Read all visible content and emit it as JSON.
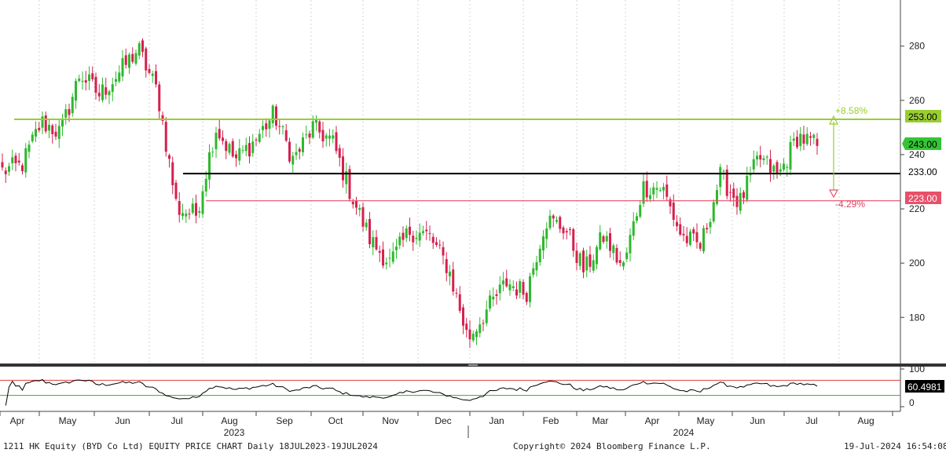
{
  "chart_data": {
    "type": "candlestick",
    "ylim": [
      163,
      297
    ],
    "yticks": [
      180,
      200,
      220,
      240,
      260,
      280
    ],
    "colors": {
      "up": "#2eb82e",
      "down": "#d6204e",
      "last_price_tag": "#35c435",
      "resistance": "#9acd32",
      "support": "#e8506a",
      "level": "#000000",
      "rsi": "#000000",
      "rsi_upper": "#e04040",
      "rsi_lower": "#30b030"
    },
    "months": [
      "Apr",
      "May",
      "Jun",
      "Jul",
      "Aug",
      "Sep",
      "Oct",
      "Nov",
      "Dec",
      "Jan",
      "Feb",
      "Mar",
      "Apr",
      "May",
      "Jun",
      "Jul",
      "Aug"
    ],
    "years": [
      "2023",
      "2024"
    ],
    "anchors": [
      {
        "label": "start",
        "value": 234
      },
      {
        "label": "May",
        "value": 236
      },
      {
        "label": "May",
        "value": 252
      },
      {
        "label": "Jun",
        "value": 248
      },
      {
        "label": "Jun",
        "value": 270
      },
      {
        "label": "Jul",
        "value": 262
      },
      {
        "label": "Jul",
        "value": 270
      },
      {
        "label": "Jul",
        "value": 279
      },
      {
        "label": "Aug",
        "value": 263
      },
      {
        "label": "Aug",
        "value": 220
      },
      {
        "label": "Aug",
        "value": 218
      },
      {
        "label": "Sep",
        "value": 250
      },
      {
        "label": "Sep",
        "value": 238
      },
      {
        "label": "Oct",
        "value": 245
      },
      {
        "label": "Oct",
        "value": 255
      },
      {
        "label": "Oct",
        "value": 238
      },
      {
        "label": "Nov",
        "value": 250
      },
      {
        "label": "Nov",
        "value": 245
      },
      {
        "label": "Nov",
        "value": 225
      },
      {
        "label": "Dec",
        "value": 208
      },
      {
        "label": "Dec",
        "value": 200
      },
      {
        "label": "Dec",
        "value": 212
      },
      {
        "label": "Jan",
        "value": 210
      },
      {
        "label": "Jan",
        "value": 198
      },
      {
        "label": "Jan",
        "value": 172
      },
      {
        "label": "Feb",
        "value": 183
      },
      {
        "label": "Feb",
        "value": 193
      },
      {
        "label": "Mar",
        "value": 189
      },
      {
        "label": "Mar",
        "value": 216
      },
      {
        "label": "Mar",
        "value": 213
      },
      {
        "label": "Apr",
        "value": 197
      },
      {
        "label": "Apr",
        "value": 210
      },
      {
        "label": "Apr",
        "value": 198
      },
      {
        "label": "Apr",
        "value": 228
      },
      {
        "label": "May",
        "value": 228
      },
      {
        "label": "May",
        "value": 210
      },
      {
        "label": "May",
        "value": 206
      },
      {
        "label": "Jun",
        "value": 232
      },
      {
        "label": "Jun",
        "value": 222
      },
      {
        "label": "Jun",
        "value": 239
      },
      {
        "label": "Jun",
        "value": 232
      },
      {
        "label": "Jul",
        "value": 247
      },
      {
        "label": "Jul",
        "value": 243
      }
    ],
    "levels": [
      {
        "value": 253,
        "label": "253.00"
      },
      {
        "value": 233,
        "label": "233.00"
      },
      {
        "value": 223,
        "label": "223.00"
      }
    ],
    "last_price": {
      "value": 243,
      "label": "243.00"
    },
    "annotations": {
      "upside": "+8.58%",
      "downside": "-4.29%"
    },
    "rsi": {
      "yticks": [
        0,
        100
      ],
      "upper": 70,
      "lower": 30,
      "last": "60.4981",
      "last_value": 60.5
    }
  },
  "footer": {
    "title": "1211 HK Equity (BYD Co Ltd) EQUITY PRICE CHART  Daily 18JUL2023-19JUL2024",
    "copyright": "Copyright© 2024 Bloomberg Finance L.P.",
    "timestamp": "19-Jul-2024 16:54:08"
  }
}
